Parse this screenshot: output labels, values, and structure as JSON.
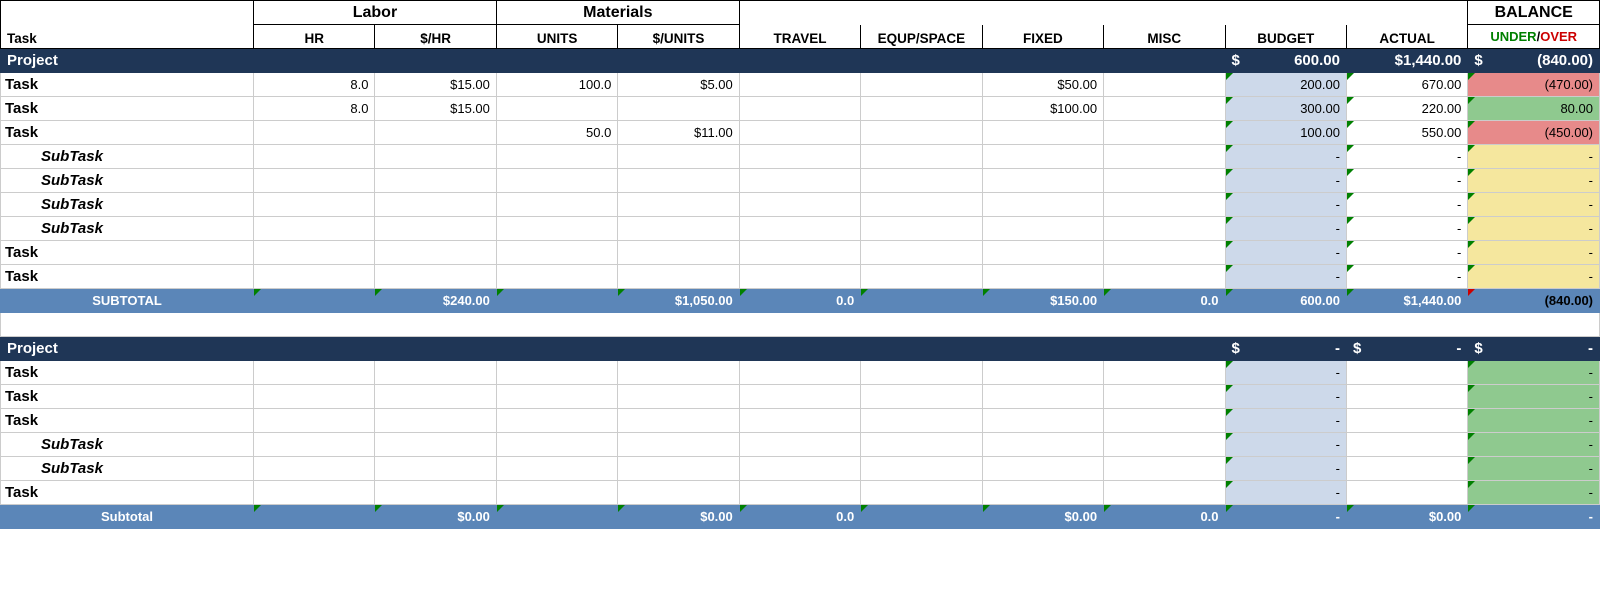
{
  "headers": {
    "task": "Task",
    "labor": "Labor",
    "hr": "HR",
    "dphr": "$/HR",
    "materials": "Materials",
    "units": "UNITS",
    "dpunits": "$/UNITS",
    "travel": "TRAVEL",
    "equip": "EQUP/SPACE",
    "fixed": "FIXED",
    "misc": "MISC",
    "budget": "BUDGET",
    "actual": "ACTUAL",
    "balance": "BALANCE",
    "under": "UNDER",
    "slash": "/",
    "over": "OVER"
  },
  "proj1": {
    "label": "Project",
    "budget_sym": "$",
    "budget": "600.00",
    "actual": "$1,440.00",
    "bal_sym": "$",
    "balance": "(840.00)"
  },
  "rows1": [
    {
      "label": "Task",
      "indent": "task",
      "hr": "8.0",
      "dphr": "$15.00",
      "units": "100.0",
      "dpunits": "$5.00",
      "travel": "",
      "equip": "",
      "fixed": "$50.00",
      "misc": "",
      "budget": "200.00",
      "actual": "670.00",
      "balance": "(470.00)",
      "balcls": "bal-red"
    },
    {
      "label": "Task",
      "indent": "task",
      "hr": "8.0",
      "dphr": "$15.00",
      "units": "",
      "dpunits": "",
      "travel": "",
      "equip": "",
      "fixed": "$100.00",
      "misc": "",
      "budget": "300.00",
      "actual": "220.00",
      "balance": "80.00",
      "balcls": "bal-green"
    },
    {
      "label": "Task",
      "indent": "task",
      "hr": "",
      "dphr": "",
      "units": "50.0",
      "dpunits": "$11.00",
      "travel": "",
      "equip": "",
      "fixed": "",
      "misc": "",
      "budget": "100.00",
      "actual": "550.00",
      "balance": "(450.00)",
      "balcls": "bal-red"
    },
    {
      "label": "SubTask",
      "indent": "sub",
      "hr": "",
      "dphr": "",
      "units": "",
      "dpunits": "",
      "travel": "",
      "equip": "",
      "fixed": "",
      "misc": "",
      "budget": "-",
      "actual": "-",
      "balance": "-",
      "balcls": "bal-yellow"
    },
    {
      "label": "SubTask",
      "indent": "sub",
      "hr": "",
      "dphr": "",
      "units": "",
      "dpunits": "",
      "travel": "",
      "equip": "",
      "fixed": "",
      "misc": "",
      "budget": "-",
      "actual": "-",
      "balance": "-",
      "balcls": "bal-yellow"
    },
    {
      "label": "SubTask",
      "indent": "sub",
      "hr": "",
      "dphr": "",
      "units": "",
      "dpunits": "",
      "travel": "",
      "equip": "",
      "fixed": "",
      "misc": "",
      "budget": "-",
      "actual": "-",
      "balance": "-",
      "balcls": "bal-yellow"
    },
    {
      "label": "SubTask",
      "indent": "sub",
      "hr": "",
      "dphr": "",
      "units": "",
      "dpunits": "",
      "travel": "",
      "equip": "",
      "fixed": "",
      "misc": "",
      "budget": "-",
      "actual": "-",
      "balance": "-",
      "balcls": "bal-yellow"
    },
    {
      "label": "Task",
      "indent": "task",
      "hr": "",
      "dphr": "",
      "units": "",
      "dpunits": "",
      "travel": "",
      "equip": "",
      "fixed": "",
      "misc": "",
      "budget": "-",
      "actual": "-",
      "balance": "-",
      "balcls": "bal-yellow"
    },
    {
      "label": "Task",
      "indent": "task",
      "hr": "",
      "dphr": "",
      "units": "",
      "dpunits": "",
      "travel": "",
      "equip": "",
      "fixed": "",
      "misc": "",
      "budget": "-",
      "actual": "-",
      "balance": "-",
      "balcls": "bal-yellow"
    }
  ],
  "sub1": {
    "label": "SUBTOTAL",
    "dphr": "$240.00",
    "dpunits": "$1,050.00",
    "travel": "0.0",
    "fixed": "$150.00",
    "misc": "0.0",
    "budget": "600.00",
    "actual": "$1,440.00",
    "balance": "(840.00)"
  },
  "proj2": {
    "label": "Project",
    "budget_sym": "$",
    "budget": "-",
    "actual_sym": "$",
    "actual": "-",
    "bal_sym": "$",
    "balance": "-"
  },
  "rows2": [
    {
      "label": "Task",
      "indent": "task",
      "budget": "-",
      "balance": "-",
      "balcls": "bal-green"
    },
    {
      "label": "Task",
      "indent": "task",
      "budget": "-",
      "balance": "-",
      "balcls": "bal-green"
    },
    {
      "label": "Task",
      "indent": "task",
      "budget": "-",
      "balance": "-",
      "balcls": "bal-green"
    },
    {
      "label": "SubTask",
      "indent": "sub",
      "budget": "-",
      "balance": "-",
      "balcls": "bal-green"
    },
    {
      "label": "SubTask",
      "indent": "sub",
      "budget": "-",
      "balance": "-",
      "balcls": "bal-green"
    },
    {
      "label": "Task",
      "indent": "task",
      "budget": "-",
      "balance": "-",
      "balcls": "bal-green"
    }
  ],
  "sub2": {
    "label": "Subtotal",
    "dphr": "$0.00",
    "dpunits": "$0.00",
    "travel": "0.0",
    "fixed": "$0.00",
    "misc": "0.0",
    "budget": "-",
    "actual": "$0.00",
    "balance": "-"
  }
}
